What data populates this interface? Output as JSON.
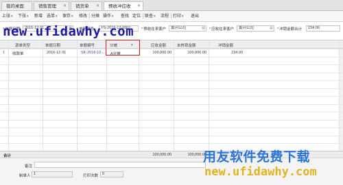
{
  "tabs": [
    {
      "label": "我的桌面",
      "active": false
    },
    {
      "label": "销售管理",
      "active": false
    },
    {
      "label": "销货单",
      "active": false
    },
    {
      "label": "预收冲应收",
      "active": true
    }
  ],
  "toolbar": [
    {
      "label": "上张",
      "menu": true
    },
    {
      "label": "下张",
      "menu": true
    },
    {
      "label": "新增",
      "menu": false
    },
    {
      "label": "选单",
      "menu": true
    },
    {
      "label": "保存",
      "menu": true
    },
    {
      "label": "修改",
      "menu": false
    },
    {
      "label": "分摊",
      "menu": false
    },
    {
      "label": "操作",
      "menu": true
    },
    {
      "label": "查找",
      "menu": false
    },
    {
      "label": "定位",
      "menu": false
    },
    {
      "label": "联查",
      "menu": true
    },
    {
      "label": "流程",
      "menu": false
    },
    {
      "label": "打印",
      "menu": true
    },
    {
      "label": "退出",
      "menu": false
    }
  ],
  "form": {
    "doc_date_label": "单据日期",
    "doc_date": "2016-12-31",
    "doc_no_label": "单据编号",
    "doc_no": "YS-2016-12-0001",
    "prepay_customer_label": "预收往来客户",
    "prepay_customer": "黄河公司",
    "ar_customer_label": "应收往来客户",
    "ar_customer": "黄河公司",
    "offset_total_label": "冲销金额合计",
    "offset_total": "234.00"
  },
  "grid": {
    "columns": [
      "源单类型",
      "单据日期",
      "单据编号",
      "分摊",
      "应收金额",
      "未核销金额",
      "冲销金额"
    ],
    "rows": [
      {
        "num": "1",
        "type": "收款单",
        "date": "2016-12-31",
        "no": "SK-2016-12-...",
        "alloc": "A分摊",
        "receivable": "100,000.00",
        "unverified": "100,000.00",
        "offset": "234.00"
      }
    ],
    "empty_rows": 12
  },
  "totals": {
    "label": "合计",
    "receivable": "100,000.00",
    "unverified": "100,000.00"
  },
  "footer": {
    "remark_label": "备注",
    "maker_label": "制单人",
    "maker": "1",
    "print_count_label": "打印次数",
    "print_count": "0"
  },
  "watermarks": {
    "top": "new.ufidawhy.com",
    "brand": "用友软件免费下载",
    "url": "new.ufidawhy.com"
  }
}
